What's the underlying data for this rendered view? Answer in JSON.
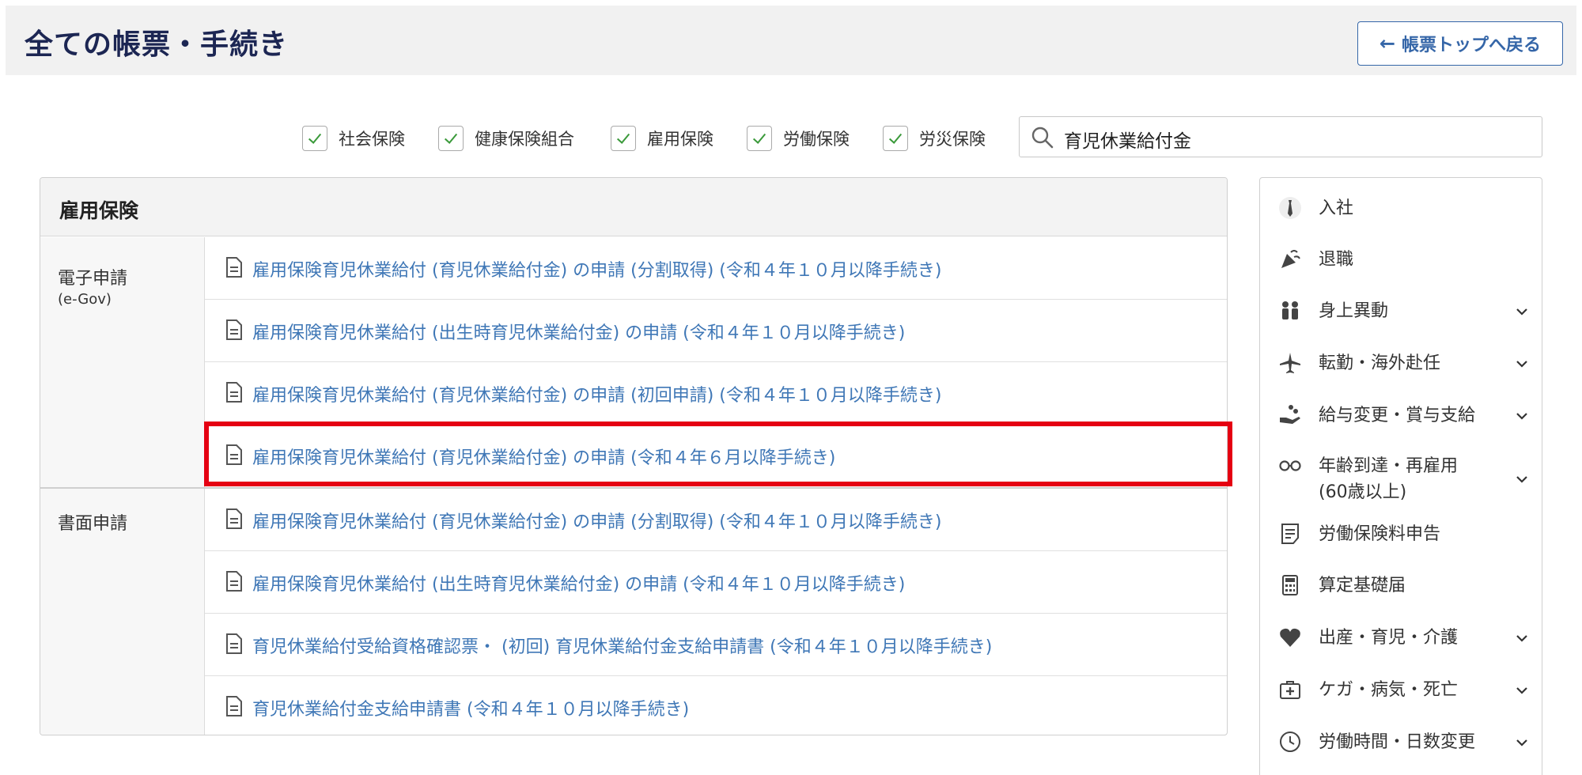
{
  "header": {
    "title": "全ての帳票・手続き",
    "back_button": "帳票トップへ戻る"
  },
  "filters": [
    {
      "label": "社会保険",
      "checked": true
    },
    {
      "label": "健康保険組合",
      "checked": true
    },
    {
      "label": "雇用保険",
      "checked": true
    },
    {
      "label": "労働保険",
      "checked": true
    },
    {
      "label": "労災保険",
      "checked": true
    }
  ],
  "search": {
    "value": "育児休業給付金",
    "icon": "search-icon"
  },
  "panel": {
    "title": "雇用保険",
    "groups": [
      {
        "label": "電子申請",
        "sublabel": "(e-Gov)",
        "items": [
          "雇用保険育児休業給付 (育児休業給付金) の申請 (分割取得) (令和４年１０月以降手続き)",
          "雇用保険育児休業給付 (出生時育児休業給付金) の申請 (令和４年１０月以降手続き)",
          "雇用保険育児休業給付 (育児休業給付金) の申請 (初回申請) (令和４年１０月以降手続き)",
          "雇用保険育児休業給付 (育児休業給付金) の申請 (令和４年６月以降手続き)"
        ]
      },
      {
        "label": "書面申請",
        "sublabel": "",
        "items": [
          "雇用保険育児休業給付 (育児休業給付金) の申請 (分割取得) (令和４年１０月以降手続き)",
          "雇用保険育児休業給付 (出生時育児休業給付金) の申請 (令和４年１０月以降手続き)",
          "育児休業給付受給資格確認票・ (初回) 育児休業給付金支給申請書 (令和４年１０月以降手続き)",
          "育児休業給付金支給申請書 (令和４年１０月以降手続き)"
        ]
      }
    ]
  },
  "sidebar": {
    "items": [
      {
        "label": "入社",
        "icon": "necktie-icon",
        "expandable": false
      },
      {
        "label": "退職",
        "icon": "party-popper-icon",
        "expandable": false
      },
      {
        "label": "身上異動",
        "icon": "people-icon",
        "expandable": true
      },
      {
        "label": "転勤・海外赴任",
        "icon": "airplane-icon",
        "expandable": true
      },
      {
        "label": "給与変更・賞与支給",
        "icon": "hand-coins-icon",
        "expandable": true
      },
      {
        "label": "年齢到達・再雇用",
        "label2": "(60歳以上)",
        "icon": "glasses-icon",
        "expandable": true
      },
      {
        "label": "労働保険料申告",
        "icon": "document-lines-icon",
        "expandable": false
      },
      {
        "label": "算定基礎届",
        "icon": "calculator-icon",
        "expandable": false
      },
      {
        "label": "出産・育児・介護",
        "icon": "heart-icon",
        "expandable": true
      },
      {
        "label": "ケガ・病気・死亡",
        "icon": "first-aid-icon",
        "expandable": true
      },
      {
        "label": "労働時間・日数変更",
        "icon": "clock-icon",
        "expandable": true
      }
    ]
  },
  "colors": {
    "title": "#1c2653",
    "link": "#3f77b6",
    "highlight": "#e50012",
    "check": "#3a9a3a"
  }
}
